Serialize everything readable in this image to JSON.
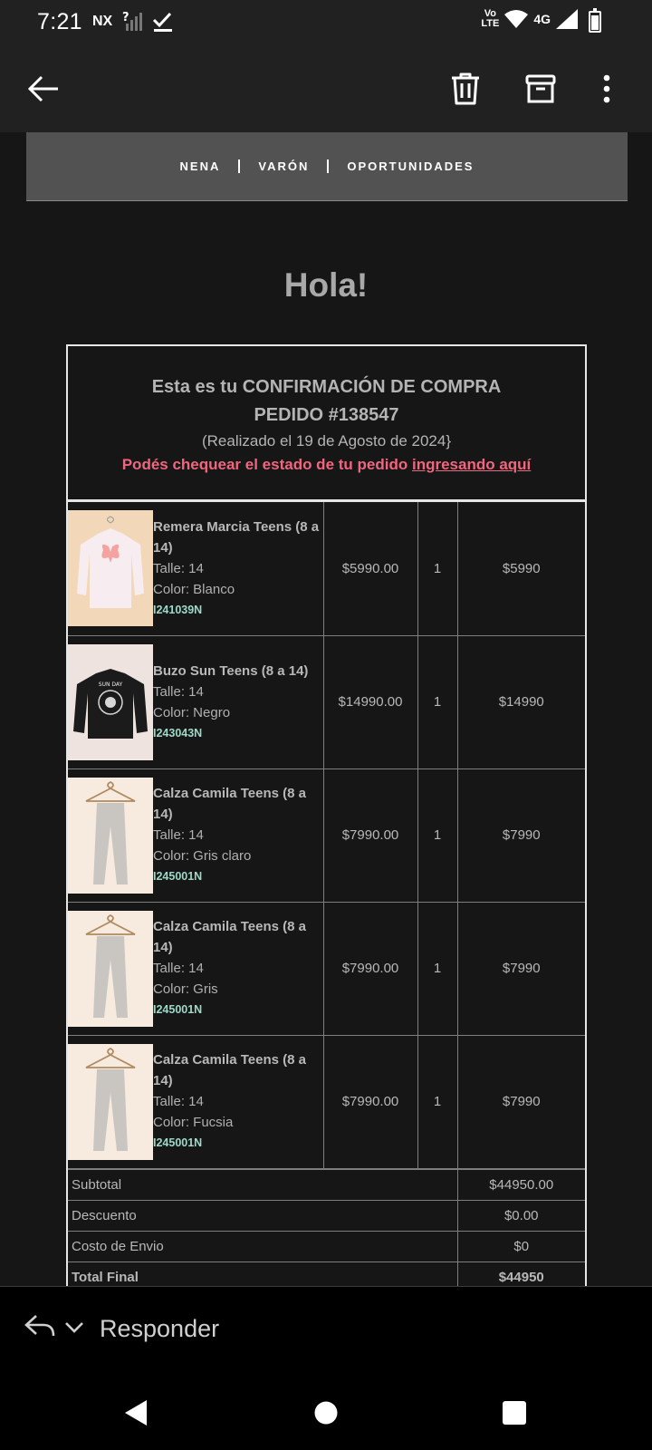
{
  "status_bar": {
    "time": "7:21",
    "carrier": "NX",
    "volte_top": "Vo",
    "volte_bottom": "LTE",
    "network": "4G"
  },
  "app_bar": {
    "icons": [
      "back-arrow-icon",
      "trash-icon",
      "archive-icon",
      "more-vert-icon"
    ]
  },
  "email": {
    "nav_links": [
      "NENA",
      "VARÓN",
      "OPORTUNIDADES"
    ],
    "greeting": "Hola!",
    "header": {
      "line1": "Esta es tu CONFIRMACIÓN DE COMPRA",
      "line2": "PEDIDO #138547",
      "line3": "(Realizado el 19 de Agosto de 2024}",
      "status_prefix": "Podés chequear el estado de tu pedido ",
      "status_link": "ingresando aquí"
    },
    "items": [
      {
        "name": "Remera Marcia Teens (8 a 14)",
        "size": "Talle: 14",
        "color": "Color: Blanco",
        "sku": "I241039N",
        "unit_price": "$5990.00",
        "qty": "1",
        "total": "$5990",
        "image": "white-shirt-butterfly"
      },
      {
        "name": "Buzo Sun Teens (8 a 14)",
        "size": "Talle: 14",
        "color": "Color: Negro",
        "sku": "I243043N",
        "unit_price": "$14990.00",
        "qty": "1",
        "total": "$14990",
        "image": "black-sweatshirt"
      },
      {
        "name": "Calza Camila Teens (8 a 14)",
        "size": "Talle: 14",
        "color": "Color: Gris claro",
        "sku": "I245001N",
        "unit_price": "$7990.00",
        "qty": "1",
        "total": "$7990",
        "image": "grey-leggings"
      },
      {
        "name": "Calza Camila Teens (8 a 14)",
        "size": "Talle: 14",
        "color": "Color: Gris",
        "sku": "I245001N",
        "unit_price": "$7990.00",
        "qty": "1",
        "total": "$7990",
        "image": "grey-leggings"
      },
      {
        "name": "Calza Camila Teens (8 a 14)",
        "size": "Talle: 14",
        "color": "Color: Fucsia",
        "sku": "I245001N",
        "unit_price": "$7990.00",
        "qty": "1",
        "total": "$7990",
        "image": "grey-leggings"
      }
    ],
    "totals": {
      "subtotal_label": "Subtotal",
      "subtotal_value": "$44950.00",
      "discount_label": "Descuento",
      "discount_value": "$0.00",
      "shipping_label": "Costo de Envio",
      "shipping_value": "$0",
      "final_label": "Total Final",
      "final_value": "$44950"
    }
  },
  "reply_bar": {
    "label": "Responder"
  },
  "colors": {
    "accent_link": "#f0667e",
    "sku": "#9ed9c7",
    "background": "#161616",
    "toolbar": "#212121"
  }
}
